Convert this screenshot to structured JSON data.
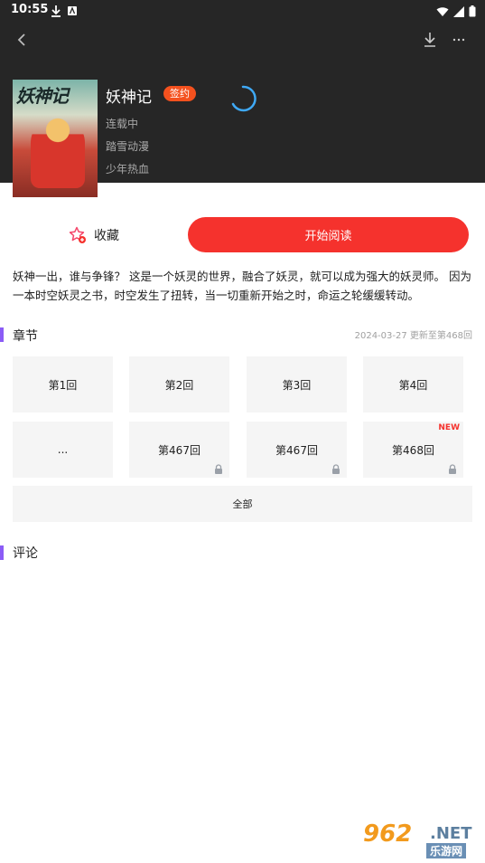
{
  "status_bar": {
    "time": "10:55"
  },
  "book": {
    "cover_title": "妖神记",
    "title": "妖神记",
    "badge": "签约",
    "status": "连载中",
    "author": "踏雪动漫",
    "genre": "少年热血"
  },
  "actions": {
    "favorite_label": "收藏",
    "read_label": "开始阅读"
  },
  "description": "妖神一出，谁与争锋？ 这是一个妖灵的世界，融合了妖灵，就可以成为强大的妖灵师。 因为一本时空妖灵之书，时空发生了扭转，当一切重新开始之时，命运之轮缓缓转动。",
  "chapters": {
    "section_title": "章节",
    "update_info": "2024-03-27 更新至第468回",
    "items": [
      {
        "label": "第1回",
        "locked": false,
        "new": false
      },
      {
        "label": "第2回",
        "locked": false,
        "new": false
      },
      {
        "label": "第3回",
        "locked": false,
        "new": false
      },
      {
        "label": "第4回",
        "locked": false,
        "new": false
      },
      {
        "label": "...",
        "locked": false,
        "new": false
      },
      {
        "label": "第467回",
        "locked": true,
        "new": false
      },
      {
        "label": "第467回",
        "locked": true,
        "new": false
      },
      {
        "label": "第468回",
        "locked": true,
        "new": true,
        "new_tag": "NEW"
      }
    ],
    "all_label": "全部"
  },
  "comments": {
    "section_title": "评论"
  },
  "watermark": {
    "number": "962",
    "suffix": ".NET",
    "site": "乐游网"
  },
  "colors": {
    "accent": "#f5322d",
    "badge": "#f4511e",
    "section_bar": "#8b5cf6",
    "header_bg": "#262626"
  }
}
